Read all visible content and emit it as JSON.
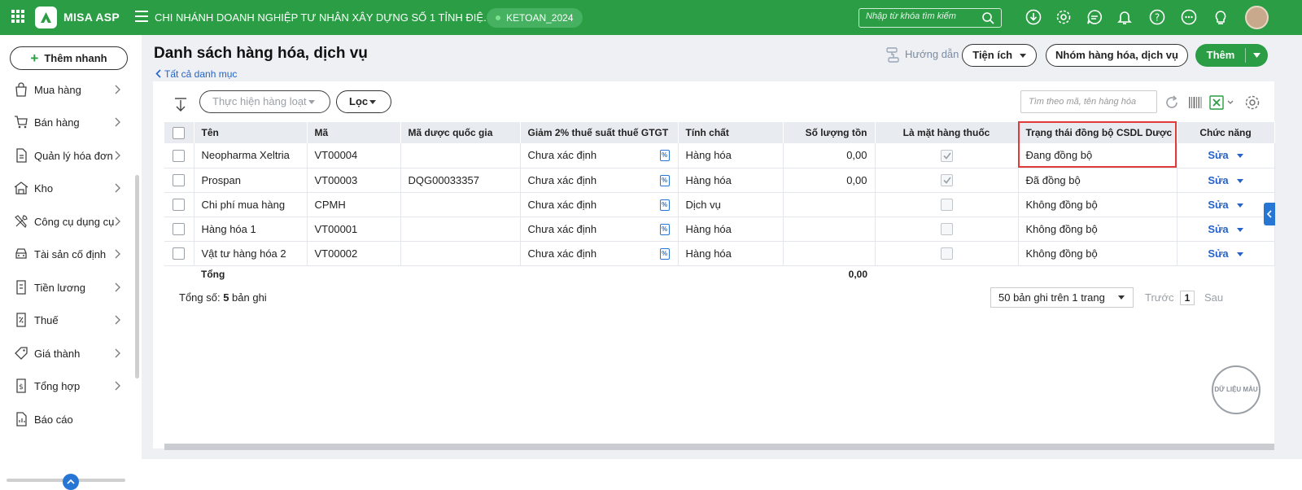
{
  "topbar": {
    "logo_text": "MISA ASP",
    "company": "CHI NHÁNH DOANH NGHIỆP TƯ NHÂN XÂY DỰNG SỐ 1 TỈNH ĐIỆ...",
    "database": "KETOAN_2024",
    "search_placeholder": "Nhập từ khóa tìm kiếm",
    "icons": [
      "download-icon",
      "settings-icon",
      "chat-icon",
      "bell-icon",
      "help-icon",
      "more-icon",
      "idea-icon"
    ]
  },
  "sidebar": {
    "quick_add": "Thêm nhanh",
    "items": [
      {
        "label": "Mua hàng",
        "icon": "shopping-bag-icon"
      },
      {
        "label": "Bán hàng",
        "icon": "cart-icon"
      },
      {
        "label": "Quản lý hóa đơn",
        "icon": "invoice-icon"
      },
      {
        "label": "Kho",
        "icon": "warehouse-icon"
      },
      {
        "label": "Công cụ dụng cụ",
        "icon": "tools-icon"
      },
      {
        "label": "Tài sản cố định",
        "icon": "car-icon"
      },
      {
        "label": "Tiền lương",
        "icon": "salary-icon"
      },
      {
        "label": "Thuế",
        "icon": "tax-icon"
      },
      {
        "label": "Giá thành",
        "icon": "price-tag-icon"
      },
      {
        "label": "Tổng hợp",
        "icon": "summary-icon"
      },
      {
        "label": "Báo cáo",
        "icon": "report-icon"
      }
    ]
  },
  "page": {
    "title": "Danh sách hàng hóa, dịch vụ",
    "back_link": "Tất cả danh mục",
    "guide": "Hướng dẫn",
    "utilities": "Tiện ích",
    "group_button": "Nhóm hàng hóa, dịch vụ",
    "add_button": "Thêm"
  },
  "toolbar": {
    "bulk_action": "Thực hiện hàng loạt",
    "filter": "Lọc",
    "search_placeholder": "Tìm theo mã, tên hàng hóa"
  },
  "table": {
    "columns": [
      "Tên",
      "Mã",
      "Mã dược quốc gia",
      "Giảm 2% thuế suất thuế GTGT",
      "Tính chất",
      "Số lượng tồn",
      "Là mặt hàng thuốc",
      "Trạng thái đồng bộ CSDL Dược",
      "Chức năng"
    ],
    "rows": [
      {
        "name": "Neopharma Xeltria",
        "code": "VT00004",
        "national_code": "",
        "vat": "Chưa xác định",
        "nature": "Hàng hóa",
        "qty": "0,00",
        "is_drug": true,
        "sync": "Đang đồng bộ",
        "action": "Sửa"
      },
      {
        "name": "Prospan",
        "code": "VT00003",
        "national_code": "DQG00033357",
        "vat": "Chưa xác định",
        "nature": "Hàng hóa",
        "qty": "0,00",
        "is_drug": true,
        "sync": "Đã đồng bộ",
        "action": "Sửa"
      },
      {
        "name": "Chi phí mua hàng",
        "code": "CPMH",
        "national_code": "",
        "vat": "Chưa xác định",
        "nature": "Dịch vụ",
        "qty": "",
        "is_drug": false,
        "sync": "Không đồng bộ",
        "action": "Sửa"
      },
      {
        "name": "Hàng hóa 1",
        "code": "VT00001",
        "national_code": "",
        "vat": "Chưa xác định",
        "nature": "Hàng hóa",
        "qty": "",
        "is_drug": false,
        "sync": "Không đồng bộ",
        "action": "Sửa"
      },
      {
        "name": "Vật tư hàng hóa 2",
        "code": "VT00002",
        "national_code": "",
        "vat": "Chưa xác định",
        "nature": "Hàng hóa",
        "qty": "",
        "is_drug": false,
        "sync": "Không đồng bộ",
        "action": "Sửa"
      }
    ],
    "total_label": "Tổng",
    "total_qty": "0,00",
    "vat_icon": "%"
  },
  "footer": {
    "count_prefix": "Tổng số: ",
    "count": "5",
    "count_suffix": " bản ghi",
    "page_size": "50 bản ghi trên 1 trang",
    "prev": "Trước",
    "page": "1",
    "next": "Sau"
  },
  "stamp": "DỮ LIỆU MẪU",
  "colors": {
    "brand": "#2a9d45",
    "link": "#2563c9",
    "highlight": "#e03a3a"
  }
}
